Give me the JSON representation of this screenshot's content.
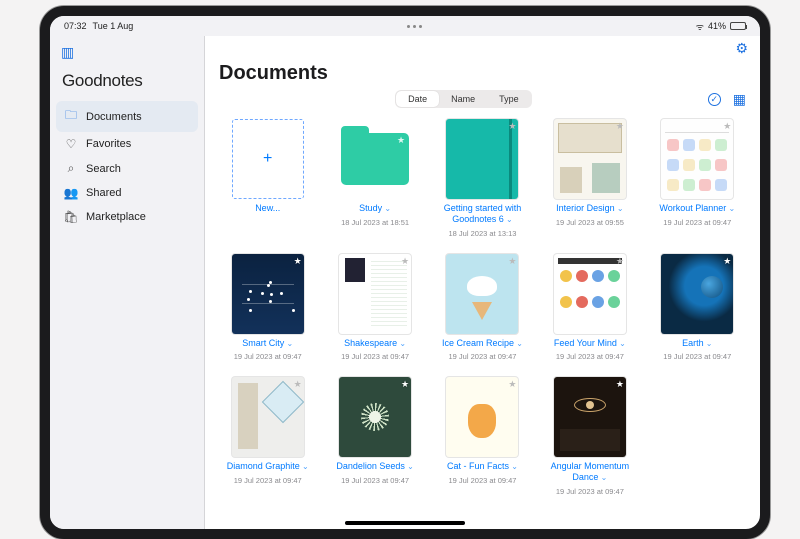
{
  "status": {
    "time": "07:32",
    "date": "Tue 1 Aug",
    "battery_pct": "41%"
  },
  "brand": "Goodnotes",
  "sidebar": {
    "items": [
      {
        "icon": "folder-icon",
        "label": "Documents",
        "active": true
      },
      {
        "icon": "heart-icon",
        "label": "Favorites",
        "active": false
      },
      {
        "icon": "search-icon",
        "label": "Search",
        "active": false
      },
      {
        "icon": "people-icon",
        "label": "Shared",
        "active": false
      },
      {
        "icon": "bag-icon",
        "label": "Marketplace",
        "active": false
      }
    ]
  },
  "page_title": "Documents",
  "sort": {
    "options": [
      "Date",
      "Name",
      "Type"
    ],
    "active": "Date"
  },
  "new_label": "New...",
  "items": [
    {
      "kind": "new"
    },
    {
      "kind": "folder",
      "title": "Study",
      "date": "18 Jul 2023 at 18:51"
    },
    {
      "kind": "doc",
      "title": "Getting started with Goodnotes 6",
      "date": "18 Jul 2023 at 13:13",
      "wide": false,
      "thumb": "getting-started",
      "bg": "#19c7b5"
    },
    {
      "kind": "doc",
      "title": "Interior Design",
      "date": "19 Jul 2023 at 09:55",
      "thumb": "interior",
      "bg": "#f8f6ef"
    },
    {
      "kind": "doc",
      "title": "Workout Planner",
      "date": "19 Jul 2023 at 09:47",
      "thumb": "workout",
      "bg": "#fefefe"
    },
    {
      "kind": "doc",
      "title": "Smart City",
      "date": "19 Jul 2023 at 09:47",
      "thumb": "smartcity",
      "bg": "#0c1f3a"
    },
    {
      "kind": "doc",
      "title": "Shakespeare",
      "date": "19 Jul 2023 at 09:47",
      "thumb": "shakespeare",
      "bg": "#fff"
    },
    {
      "kind": "doc",
      "title": "Ice Cream Recipe",
      "date": "19 Jul 2023 at 09:47",
      "thumb": "icecream",
      "bg": "#bfe3ef"
    },
    {
      "kind": "doc",
      "title": "Feed Your Mind",
      "date": "19 Jul 2023 at 09:47",
      "thumb": "feedmind",
      "bg": "#fff"
    },
    {
      "kind": "doc",
      "title": "Earth",
      "date": "19 Jul 2023 at 09:47",
      "thumb": "earth",
      "bg": "#0a2a44"
    },
    {
      "kind": "doc",
      "title": "Diamond Graphite",
      "date": "19 Jul 2023 at 09:47",
      "thumb": "diamond",
      "bg": "#eeeeec"
    },
    {
      "kind": "doc",
      "title": "Dandelion Seeds",
      "date": "19 Jul 2023 at 09:47",
      "thumb": "dandelion",
      "bg": "#2e4a3c"
    },
    {
      "kind": "doc",
      "title": "Cat - Fun Facts",
      "date": "19 Jul 2023 at 09:47",
      "thumb": "cat",
      "bg": "#fffdee"
    },
    {
      "kind": "doc",
      "title": "Angular Momentum Dance",
      "date": "19 Jul 2023 at 09:47",
      "thumb": "angular",
      "bg": "#1c1410"
    }
  ],
  "icons": {
    "folder-icon": "🗀",
    "heart-icon": "♡",
    "search-icon": "⌕",
    "people-icon": "👥",
    "bag-icon": "🛍",
    "wifi-glyph": "ᯤ",
    "check-circle": "✓",
    "grid-glyph": "▦",
    "gear-glyph": "⚙",
    "panel-glyph": "▥"
  }
}
